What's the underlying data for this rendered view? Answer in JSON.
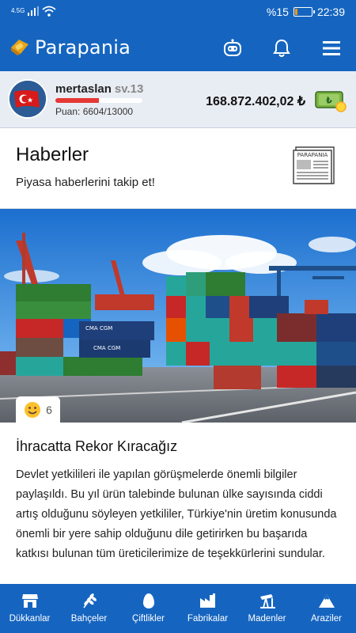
{
  "status_bar": {
    "network": "4.5G",
    "battery": "%15",
    "battery_level": 0.15,
    "time": "22:39"
  },
  "app_bar": {
    "title": "Parapania",
    "icons": [
      "logo-icon",
      "robot-icon",
      "bell-icon",
      "menu-icon"
    ]
  },
  "profile": {
    "username": "mertaslan",
    "level": "sv.13",
    "xp_fraction": 0.5,
    "points": "Puan: 6604/13000",
    "balance": "168.872.402,02 ₺"
  },
  "news": {
    "title": "Haberler",
    "subtitle": "Piyasa haberlerini takip et!",
    "newspaper_label": "PARAPANIA"
  },
  "article": {
    "reaction_count": "6",
    "image_labels": [
      "CMA CGM"
    ],
    "title": "İhracatta Rekor Kıracağız",
    "body": "Devlet yetkilileri ile yapılan görüşmelerde önemli bilgiler paylaşıldı. Bu yıl ürün talebinde bulunan ülke sayısında ciddi artış olduğunu söyleyen yetkililer, Türkiye'nin üretim konusunda önemli bir yere sahip olduğunu dile getirirken bu başarıda katkısı bulunan tüm üreticilerimize de teşekkürlerini sundular."
  },
  "bottom_nav": [
    {
      "label": "Dükkanlar",
      "icon": "store-icon"
    },
    {
      "label": "Bahçeler",
      "icon": "wheat-icon"
    },
    {
      "label": "Çiftlikler",
      "icon": "egg-icon"
    },
    {
      "label": "Fabrikalar",
      "icon": "factory-icon"
    },
    {
      "label": "Madenler",
      "icon": "pump-icon"
    },
    {
      "label": "Araziler",
      "icon": "mountain-icon"
    }
  ],
  "colors": {
    "primary": "#1565c0",
    "accent_red": "#e53935",
    "profile_bg": "#e8edf3"
  }
}
